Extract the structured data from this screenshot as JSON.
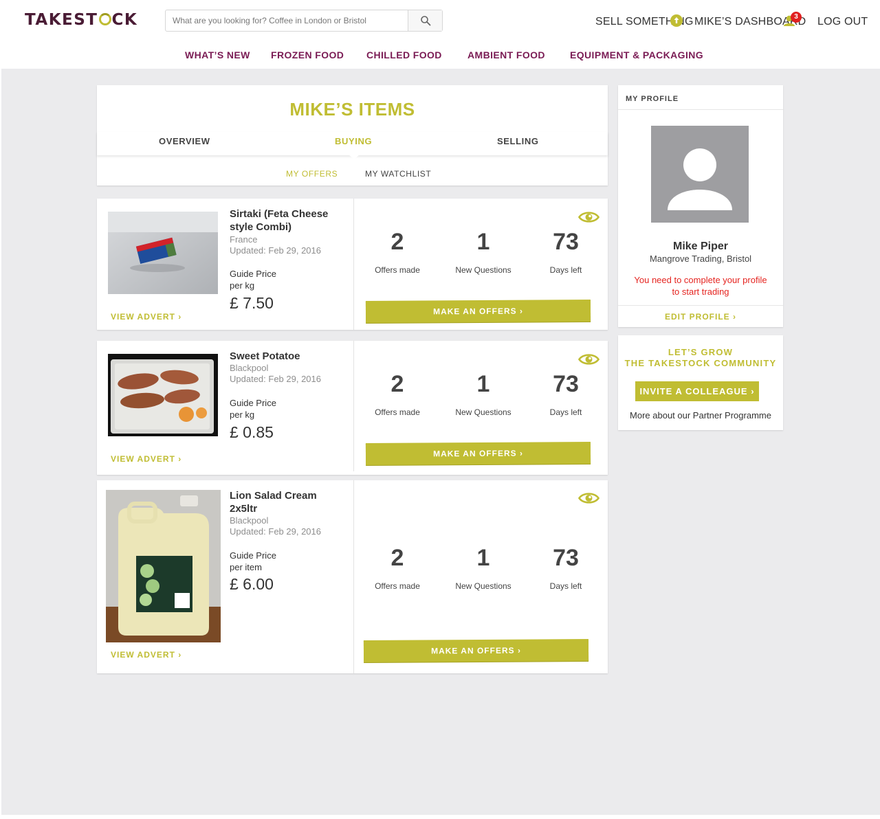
{
  "header": {
    "logo": "TAKESTOCK",
    "search_placeholder": "What are you looking for? Coffee in London or Bristol",
    "sell_label": "SELL SOMETHING",
    "dashboard_label": "MIKE’S DASHBOARD",
    "notification_count": "3",
    "logout_label": "LOG OUT",
    "nav": [
      "WHAT’S NEW",
      "FROZEN FOOD",
      "CHILLED FOOD",
      "AMBIENT FOOD",
      "EQUIPMENT & PACKAGING"
    ]
  },
  "items_panel": {
    "title": "MIKE’S ITEMS",
    "tabs": [
      "OVERVIEW",
      "BUYING",
      "SELLING"
    ],
    "active_tab": "BUYING",
    "subtabs": [
      "MY OFFERS",
      "MY WATCHLIST"
    ],
    "active_subtab": "MY OFFERS"
  },
  "items": [
    {
      "name": "Sirtaki (Feta Cheese style Combi)",
      "location": "France",
      "updated": "Updated: Feb 29, 2016",
      "guide_price_label": "Guide Price",
      "unit": "per kg",
      "price": "£ 7.50",
      "view_label": "VIEW ADVERT ›",
      "offers_made": "2",
      "offers_made_label": "Offers made",
      "new_questions": "1",
      "new_questions_label": "New Questions",
      "days_left": "73",
      "days_left_label": "Days left",
      "button_label": "MAKE AN OFFERS ›"
    },
    {
      "name": "Sweet Potatoe",
      "location": "Blackpool",
      "updated": "Updated: Feb 29, 2016",
      "guide_price_label": "Guide Price",
      "unit": "per kg",
      "price": "£ 0.85",
      "view_label": "VIEW ADVERT ›",
      "offers_made": "2",
      "offers_made_label": "Offers made",
      "new_questions": "1",
      "new_questions_label": "New Questions",
      "days_left": "73",
      "days_left_label": "Days left",
      "button_label": "MAKE AN OFFERS ›"
    },
    {
      "name": "Lion Salad Cream 2x5ltr",
      "location": "Blackpool",
      "updated": "Updated: Feb 29, 2016",
      "guide_price_label": "Guide Price",
      "unit": "per item",
      "price": "£ 6.00",
      "view_label": "VIEW ADVERT ›",
      "offers_made": "2",
      "offers_made_label": "Offers made",
      "new_questions": "1",
      "new_questions_label": "New Questions",
      "days_left": "73",
      "days_left_label": "Days left",
      "button_label": "MAKE AN OFFERS ›"
    }
  ],
  "profile": {
    "heading": "MY PROFILE",
    "name": "Mike Piper",
    "company": "Mangrove Trading, Bristol",
    "warning": "You need to complete your profile to start trading",
    "edit_label": "EDIT PROFILE ›"
  },
  "community": {
    "title_line1": "LET’S GROW",
    "title_line2": "THE TAKESTOCK COMMUNITY",
    "invite_label": "INVITE A COLLEAGUE ›",
    "partner_text": "More about our Partner Programme"
  },
  "colors": {
    "accent": "#c0bd33",
    "brand": "#4a1c35",
    "nav": "#7a1b54",
    "warning": "#e52420"
  }
}
